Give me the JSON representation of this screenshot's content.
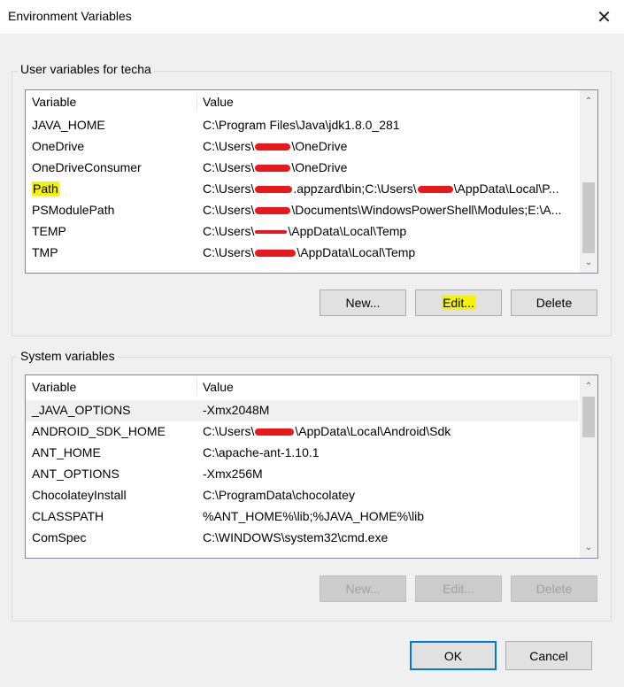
{
  "window": {
    "title": "Environment Variables"
  },
  "user_section": {
    "label": "User variables for techa",
    "columns": [
      "Variable",
      "Value"
    ],
    "rows": [
      {
        "name": "JAVA_HOME",
        "value": "C:\\Program Files\\Java\\jdk1.8.0_281"
      },
      {
        "name": "OneDrive",
        "value": "C:\\Users\\",
        "value_tail": "\\OneDrive"
      },
      {
        "name": "OneDriveConsumer",
        "value": "C:\\Users\\",
        "value_tail": "\\OneDrive"
      },
      {
        "name": "Path",
        "value": "C:\\Users\\",
        "value_tail": ".appzard\\bin;C:\\Users\\",
        "value_tail2": "\\AppData\\Local\\P..."
      },
      {
        "name": "PSModulePath",
        "value": "C:\\Users\\",
        "value_tail": "\\Documents\\WindowsPowerShell\\Modules;E:\\A..."
      },
      {
        "name": "TEMP",
        "value": "C:\\Users\\",
        "value_tail": "\\AppData\\Local\\Temp"
      },
      {
        "name": "TMP",
        "value": "C:\\Users\\",
        "value_tail": "\\AppData\\Local\\Temp"
      }
    ],
    "buttons": {
      "new": "New...",
      "edit": "Edit...",
      "delete": "Delete"
    }
  },
  "system_section": {
    "label": "System variables",
    "columns": [
      "Variable",
      "Value"
    ],
    "rows": [
      {
        "name": "_JAVA_OPTIONS",
        "value": "-Xmx2048M"
      },
      {
        "name": "ANDROID_SDK_HOME",
        "value": "C:\\Users\\",
        "value_tail": "\\AppData\\Local\\Android\\Sdk"
      },
      {
        "name": "ANT_HOME",
        "value": "C:\\apache-ant-1.10.1"
      },
      {
        "name": "ANT_OPTIONS",
        "value": "-Xmx256M"
      },
      {
        "name": "ChocolateyInstall",
        "value": "C:\\ProgramData\\chocolatey"
      },
      {
        "name": "CLASSPATH",
        "value": "%ANT_HOME%\\lib;%JAVA_HOME%\\lib"
      },
      {
        "name": "ComSpec",
        "value": "C:\\WINDOWS\\system32\\cmd.exe"
      }
    ],
    "buttons": {
      "new": "New...",
      "edit": "Edit...",
      "delete": "Delete"
    }
  },
  "footer": {
    "ok": "OK",
    "cancel": "Cancel"
  },
  "colors": {
    "highlight": "#f4f300",
    "redaction": "#e8191c",
    "accent": "#0078d7"
  },
  "icons": {
    "close": "close-icon",
    "scroll_up": "chevron-up-icon",
    "scroll_down": "chevron-down-icon"
  }
}
